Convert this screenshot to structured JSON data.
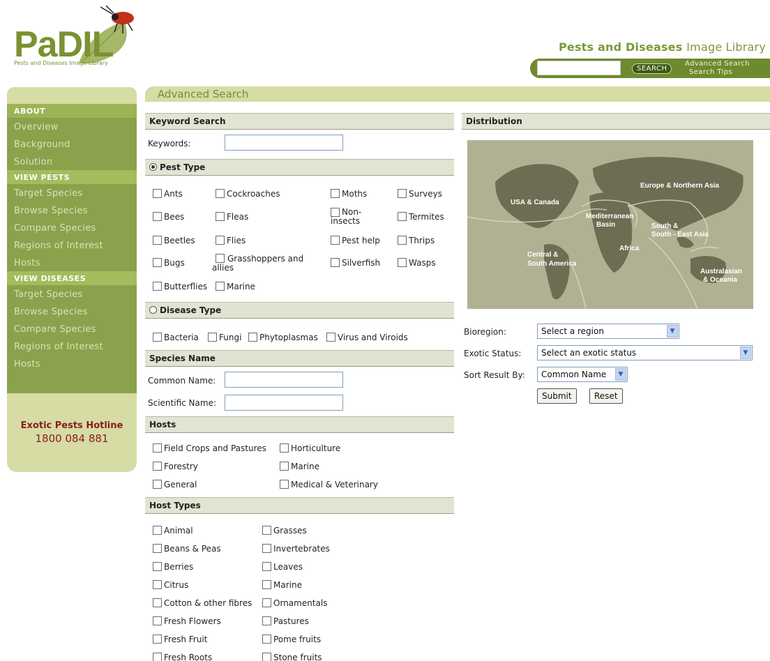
{
  "header": {
    "logo_text": "PaDIL",
    "logo_tagline": "Pests and Diseases Image Library",
    "site_title_bold": "Pests and Diseases",
    "site_title_light": "Image Library",
    "search_input_value": "",
    "search_button": "SEARCH",
    "advanced_search_link": "Advanced Search",
    "search_tips_link": "Search Tips",
    "accent_color": "#6e8a2e"
  },
  "sidebar": {
    "sections": [
      {
        "heading": "ABOUT",
        "items": [
          "Overview",
          "Background",
          "Solution"
        ]
      },
      {
        "heading": "VIEW PESTS",
        "items": [
          "Target Species",
          "Browse Species",
          "Compare Species",
          "Regions of Interest",
          "Hosts"
        ]
      },
      {
        "heading": "VIEW DISEASES",
        "items": [
          "Target Species",
          "Browse Species",
          "Compare Species",
          "Regions of Interest",
          "Hosts"
        ]
      }
    ],
    "hotline_title": "Exotic Pests Hotline",
    "hotline_number": "1800 084 881"
  },
  "main": {
    "title": "Advanced Search",
    "keyword_section": "Keyword Search",
    "keywords_label": "Keywords:",
    "keywords_value": "",
    "pest_type_section": "Pest Type",
    "pest_type_selected": true,
    "pest_types": [
      "Ants",
      "Cockroaches",
      "Moths",
      "Surveys",
      "Bees",
      "Fleas",
      "Non-insects",
      "Termites",
      "Beetles",
      "Flies",
      "Pest help",
      "Thrips",
      "Bugs",
      "Grasshoppers and allies",
      "Silverfish",
      "Wasps",
      "Butterflies",
      "Marine"
    ],
    "disease_type_section": "Disease Type",
    "disease_type_selected": false,
    "disease_types": [
      "Bacteria",
      "Fungi",
      "Phytoplasmas",
      "Virus and Viroids"
    ],
    "species_section": "Species Name",
    "common_name_label": "Common Name:",
    "common_name_value": "",
    "scientific_name_label": "Scientific Name:",
    "scientific_name_value": "",
    "hosts_section": "Hosts",
    "hosts": [
      "Field Crops and Pastures",
      "Horticulture",
      "Forestry",
      "Marine",
      "General",
      "Medical & Veterinary"
    ],
    "host_types_section": "Host Types",
    "host_types_col1": [
      "Animal",
      "Beans & Peas",
      "Berries",
      "Citrus",
      "Cotton & other fibres",
      "Fresh Flowers",
      "Fresh Fruit",
      "Fresh Roots"
    ],
    "host_types_col2": [
      "Grasses",
      "Invertebrates",
      "Leaves",
      "Marine",
      "Ornamentals",
      "Pastures",
      "Pome fruits",
      "Stone fruits"
    ]
  },
  "distribution": {
    "section": "Distribution",
    "map_regions": [
      "Europe & Northern Asia",
      "USA & Canada",
      "Mediterranean Basin",
      "South & South - East Asia",
      "Africa",
      "Central & South America",
      "Australasian & Oceania"
    ],
    "bioregion_label": "Bioregion:",
    "bioregion_value": "Select a region",
    "exotic_label": "Exotic Status:",
    "exotic_value": "Select an exotic status",
    "sort_label": "Sort Result By:",
    "sort_value": "Common Name",
    "submit_label": "Submit",
    "reset_label": "Reset"
  }
}
